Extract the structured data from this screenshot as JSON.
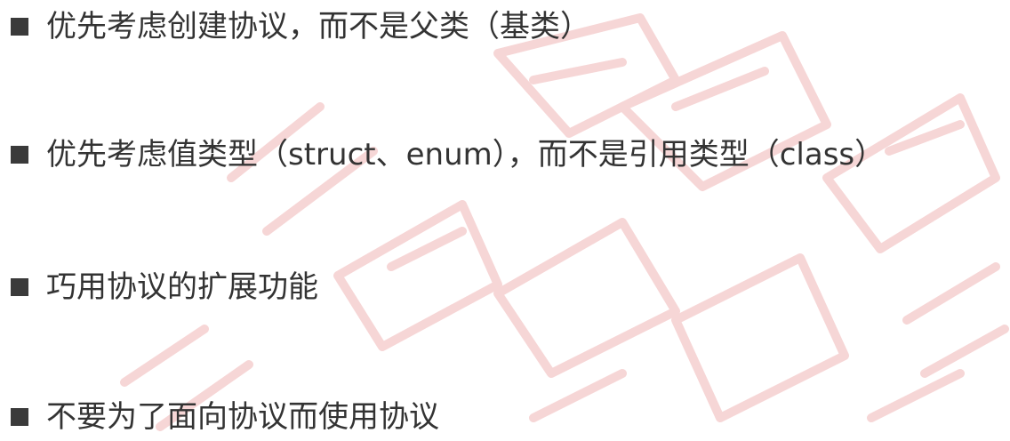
{
  "bullets": [
    {
      "text": "优先考虑创建协议，而不是父类（基类）"
    },
    {
      "text": "优先考虑值类型（struct、enum），而不是引用类型（class）"
    },
    {
      "text": "巧用协议的扩展功能"
    },
    {
      "text": "不要为了面向协议而使用协议"
    }
  ],
  "colors": {
    "text": "#333333",
    "bullet": "#3a3a3a",
    "watermark": "#f3c8c8"
  }
}
